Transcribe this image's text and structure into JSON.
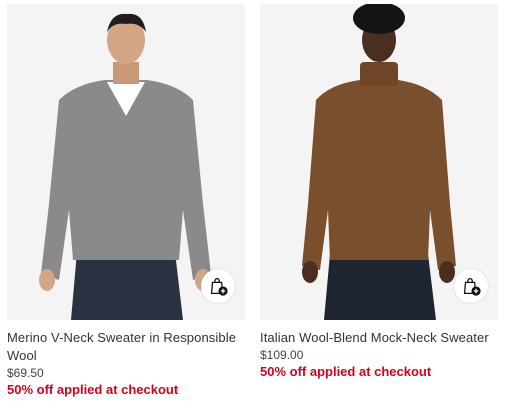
{
  "products": [
    {
      "title": "Merino V-Neck Sweater in Responsible Wool",
      "price": "$69.50",
      "promo": "50% off applied at checkout",
      "sweater_color": "#8a8a8a",
      "icon": "add-to-bag-icon"
    },
    {
      "title": "Italian Wool-Blend Mock-Neck Sweater",
      "price": "$109.00",
      "promo": "50% off applied at checkout",
      "sweater_color": "#7a4f2d",
      "icon": "add-to-bag-icon"
    }
  ],
  "colors": {
    "promo": "#d6001c",
    "image_bg": "#f4f4f4"
  }
}
